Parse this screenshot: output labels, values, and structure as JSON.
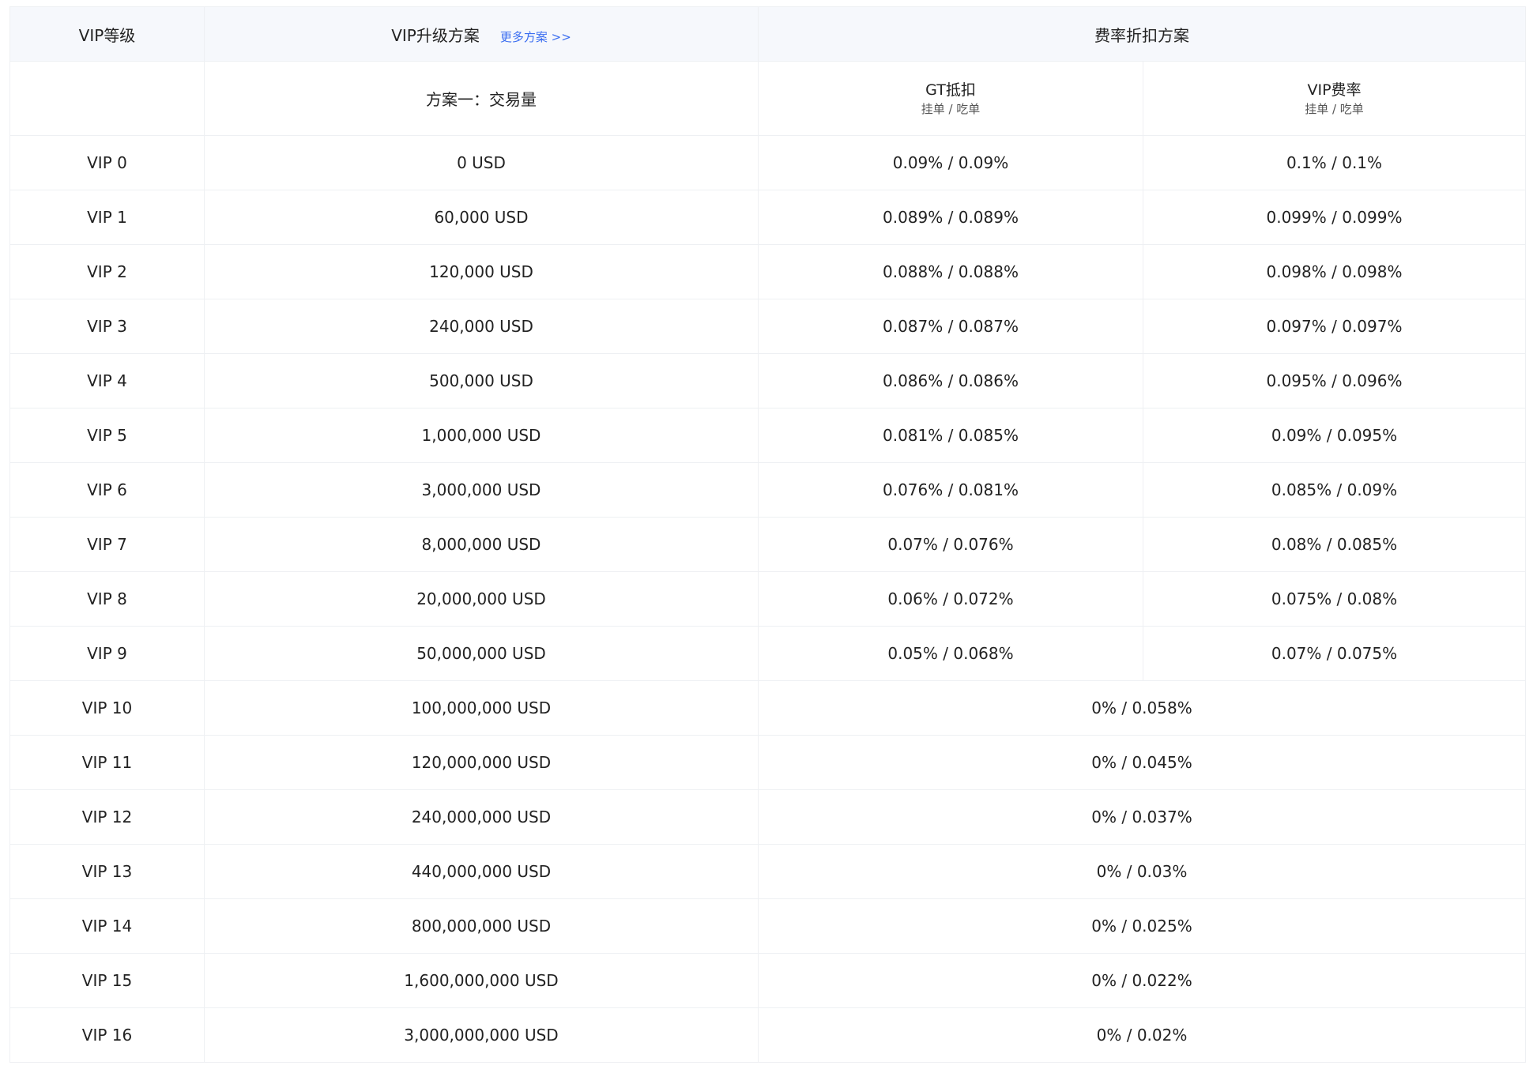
{
  "header": {
    "col_level": "VIP等级",
    "col_upgrade": "VIP升级方案",
    "more_link": "更多方案 >>",
    "col_discount": "费率折扣方案"
  },
  "subheader": {
    "plan_one": "方案一：交易量",
    "gt_title": "GT抵扣",
    "gt_caption": "挂单 / 吃单",
    "vip_title": "VIP费率",
    "vip_caption": "挂单 / 吃单"
  },
  "rows": [
    {
      "level": "VIP 0",
      "volume": "0 USD",
      "gt": "0.09% / 0.09%",
      "vip": "0.1% / 0.1%"
    },
    {
      "level": "VIP 1",
      "volume": "60,000 USD",
      "gt": "0.089% / 0.089%",
      "vip": "0.099% / 0.099%"
    },
    {
      "level": "VIP 2",
      "volume": "120,000 USD",
      "gt": "0.088% / 0.088%",
      "vip": "0.098% / 0.098%"
    },
    {
      "level": "VIP 3",
      "volume": "240,000 USD",
      "gt": "0.087% / 0.087%",
      "vip": "0.097% / 0.097%"
    },
    {
      "level": "VIP 4",
      "volume": "500,000 USD",
      "gt": "0.086% / 0.086%",
      "vip": "0.095% / 0.096%"
    },
    {
      "level": "VIP 5",
      "volume": "1,000,000 USD",
      "gt": "0.081% / 0.085%",
      "vip": "0.09% / 0.095%"
    },
    {
      "level": "VIP 6",
      "volume": "3,000,000 USD",
      "gt": "0.076% / 0.081%",
      "vip": "0.085% / 0.09%"
    },
    {
      "level": "VIP 7",
      "volume": "8,000,000 USD",
      "gt": "0.07% / 0.076%",
      "vip": "0.08% / 0.085%"
    },
    {
      "level": "VIP 8",
      "volume": "20,000,000 USD",
      "gt": "0.06% / 0.072%",
      "vip": "0.075% / 0.08%"
    },
    {
      "level": "VIP 9",
      "volume": "50,000,000 USD",
      "gt": "0.05% / 0.068%",
      "vip": "0.07% / 0.075%"
    },
    {
      "level": "VIP 10",
      "volume": "100,000,000 USD",
      "merged": "0% / 0.058%"
    },
    {
      "level": "VIP 11",
      "volume": "120,000,000 USD",
      "merged": "0% / 0.045%"
    },
    {
      "level": "VIP 12",
      "volume": "240,000,000 USD",
      "merged": "0% / 0.037%"
    },
    {
      "level": "VIP 13",
      "volume": "440,000,000 USD",
      "merged": "0% / 0.03%"
    },
    {
      "level": "VIP 14",
      "volume": "800,000,000 USD",
      "merged": "0% / 0.025%"
    },
    {
      "level": "VIP 15",
      "volume": "1,600,000,000 USD",
      "merged": "0% / 0.022%"
    },
    {
      "level": "VIP 16",
      "volume": "3,000,000,000 USD",
      "merged": "0% / 0.02%"
    }
  ],
  "colors": {
    "header_bg": "#f6f8fc",
    "border": "#eef0f3",
    "link": "#3a6df0"
  }
}
